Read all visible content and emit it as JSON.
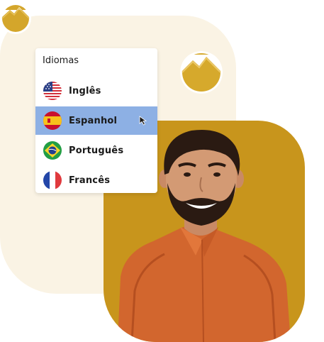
{
  "language_menu": {
    "title": "Idiomas",
    "items": [
      {
        "label": "Inglês",
        "flag": "usa-flag-icon",
        "selected": false
      },
      {
        "label": "Espanhol",
        "flag": "spain-flag-icon",
        "selected": true
      },
      {
        "label": "Português",
        "flag": "brazil-flag-icon",
        "selected": false
      },
      {
        "label": "Francês",
        "flag": "france-flag-icon",
        "selected": false
      }
    ]
  },
  "colors": {
    "cream_background": "#faf3e4",
    "gold_background": "#c8951c",
    "selected_highlight": "#8db0e4",
    "logo_gold": "#d9ad2c"
  },
  "icons": {
    "logo": "mountain-logo-icon",
    "cursor": "mouse-pointer-icon"
  }
}
